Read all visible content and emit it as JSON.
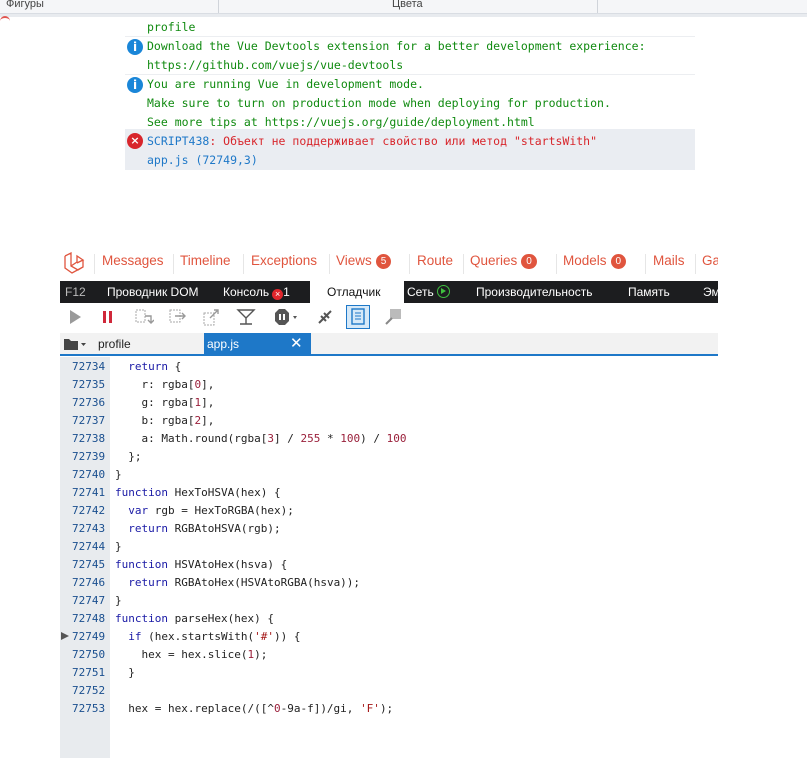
{
  "header": {
    "col1": "Фигуры",
    "col2": "Цвета"
  },
  "console": {
    "lines": [
      "profile",
      "Download the Vue Devtools extension for a better development experience:",
      "https://github.com/vuejs/vue-devtools",
      "You are running Vue in development mode.",
      "Make sure to turn on production mode when deploying for production.",
      "See more tips at https://vuejs.org/guide/deployment.html"
    ],
    "error_code": "SCRIPT438",
    "error_message": ": Объект не поддерживает свойство или метод \"startsWith\"",
    "error_location": "app.js (72749,3)"
  },
  "debugbar": {
    "items": [
      "Messages",
      "Timeline",
      "Exceptions",
      "Views",
      "Route",
      "Queries",
      "Models",
      "Mails",
      "Ga"
    ],
    "views_count": "5",
    "queries_count": "0",
    "models_count": "0"
  },
  "devtools": {
    "tabs": [
      "F12",
      "Проводник DOM",
      "Консоль",
      "Отладчик",
      "Сеть",
      "Производительность",
      "Память",
      "Эм"
    ],
    "console_errors": "1",
    "active_tab": "Отладчик"
  },
  "files": {
    "tab1": "profile",
    "tab2": "app.js"
  },
  "code": {
    "breakpoint_line": "72749",
    "lines": [
      {
        "n": "72734",
        "t": "  return {"
      },
      {
        "n": "72735",
        "t": "    r: rgba[0],"
      },
      {
        "n": "72736",
        "t": "    g: rgba[1],"
      },
      {
        "n": "72737",
        "t": "    b: rgba[2],"
      },
      {
        "n": "72738",
        "t": "    a: Math.round(rgba[3] / 255 * 100) / 100"
      },
      {
        "n": "72739",
        "t": "  };"
      },
      {
        "n": "72740",
        "t": "}"
      },
      {
        "n": "72741",
        "t": "function HexToHSVA(hex) {"
      },
      {
        "n": "72742",
        "t": "  var rgb = HexToRGBA(hex);"
      },
      {
        "n": "72743",
        "t": "  return RGBAtoHSVA(rgb);"
      },
      {
        "n": "72744",
        "t": "}"
      },
      {
        "n": "72745",
        "t": "function HSVAtoHex(hsva) {"
      },
      {
        "n": "72746",
        "t": "  return RGBAtoHex(HSVAtoRGBA(hsva));"
      },
      {
        "n": "72747",
        "t": "}"
      },
      {
        "n": "72748",
        "t": "function parseHex(hex) {"
      },
      {
        "n": "72749",
        "t": "  if (hex.startsWith('#')) {"
      },
      {
        "n": "72750",
        "t": "    hex = hex.slice(1);"
      },
      {
        "n": "72751",
        "t": "  }"
      },
      {
        "n": "72752",
        "t": ""
      },
      {
        "n": "72753",
        "t": "  hex = hex.replace(/([^0-9a-f])/gi, 'F');"
      }
    ]
  },
  "colors": {
    "accent": "#1e78c8",
    "debugbar": "#e0553e",
    "error": "#d8262c",
    "info": "#1a86d8",
    "success": "#108a10"
  }
}
